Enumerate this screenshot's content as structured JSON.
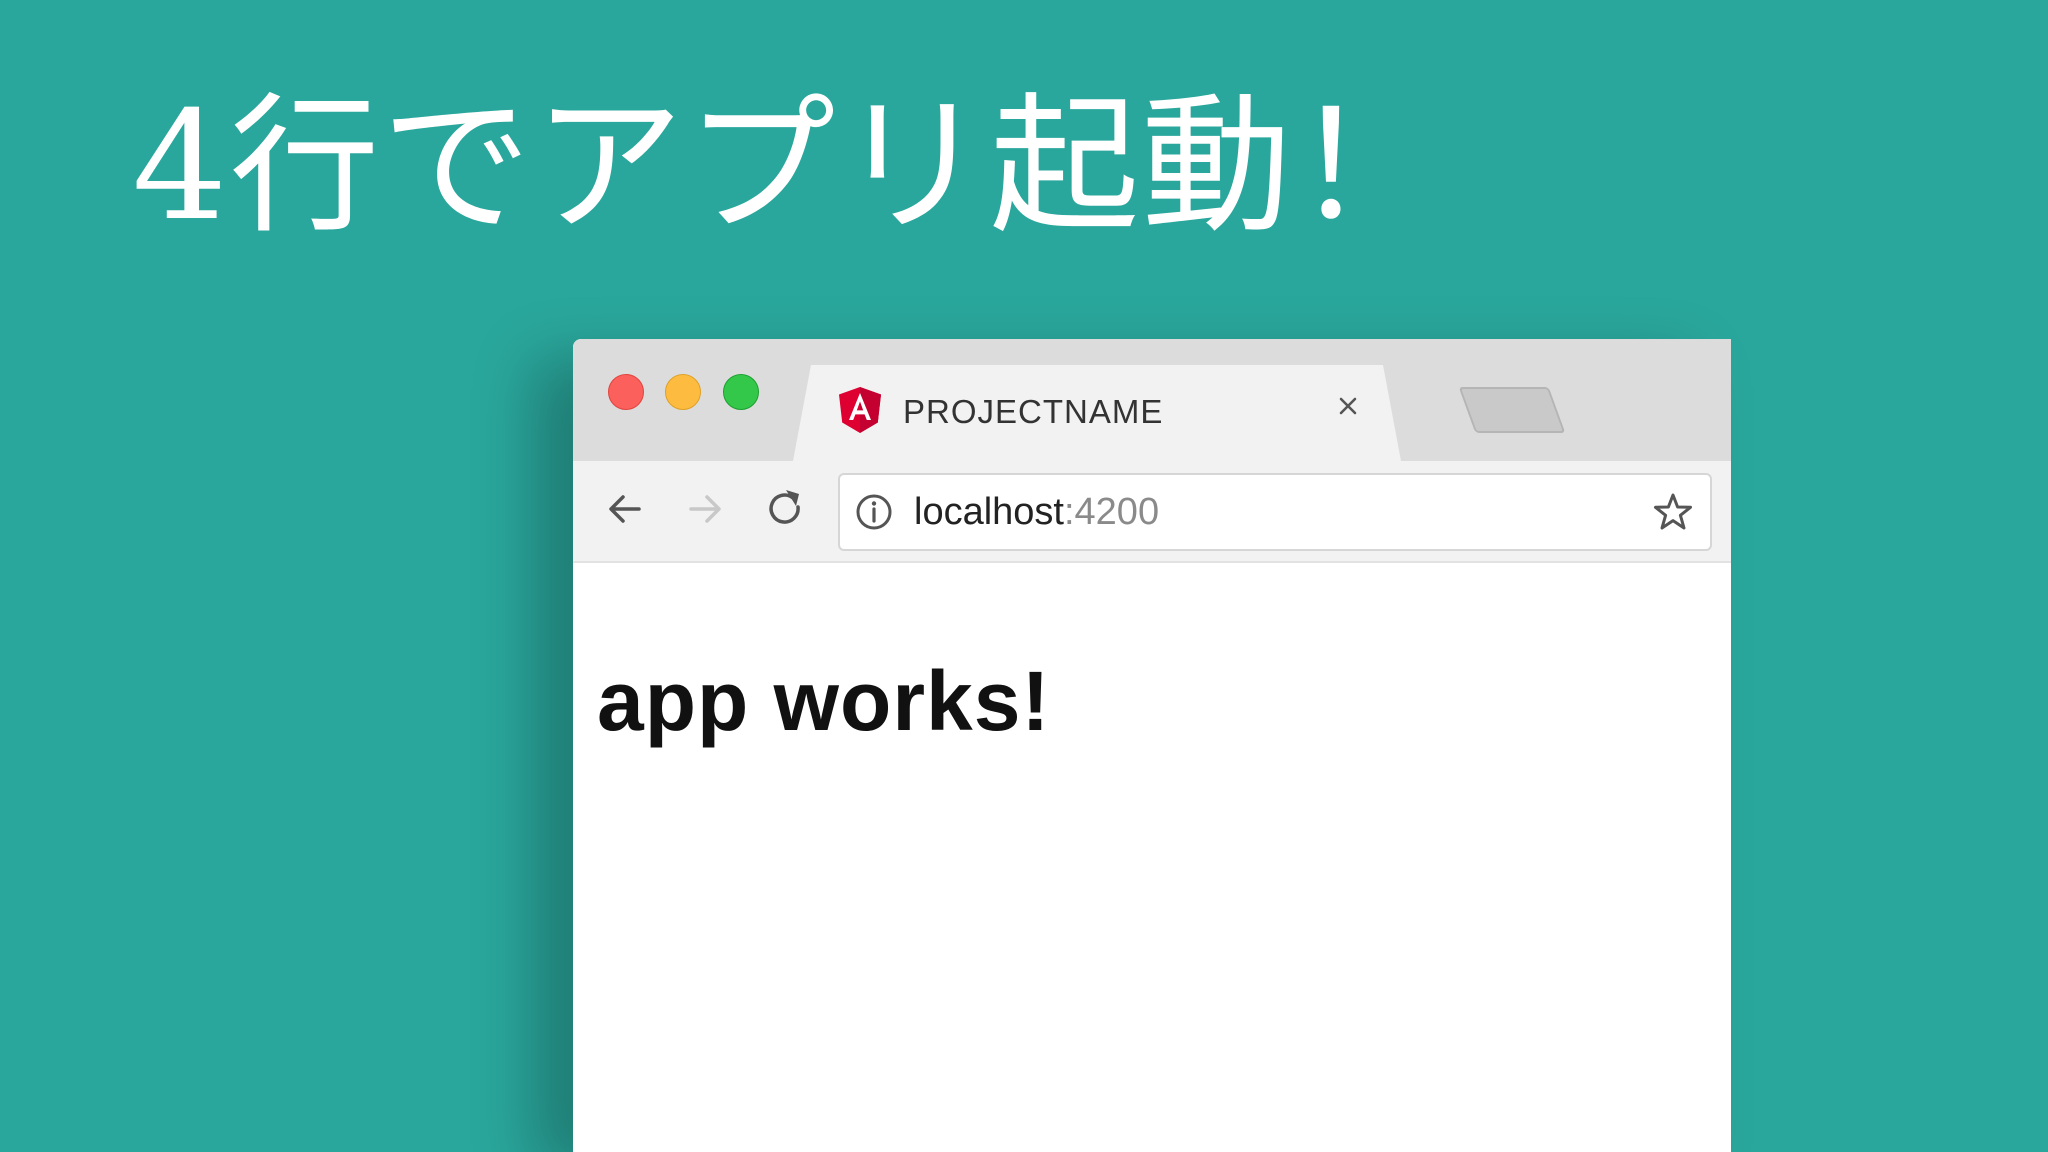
{
  "slide": {
    "title": "4行でアプリ起動！"
  },
  "browser": {
    "tab": {
      "title": "PROJECTNAME",
      "favicon": "angular-logo-icon",
      "close": "close-icon"
    },
    "toolbar": {
      "back": "arrow-left-icon",
      "forward": "arrow-right-icon",
      "reload": "reload-icon"
    },
    "address_bar": {
      "host": "localhost",
      "port": ":4200",
      "info": "info-icon",
      "bookmark": "star-icon"
    },
    "page": {
      "heading": "app works!"
    }
  },
  "colors": {
    "background": "#2aa79c",
    "angular_red": "#dd0031",
    "traffic_close": "#fc605c",
    "traffic_minimize": "#fdbc40",
    "traffic_maximize": "#34c84a"
  }
}
